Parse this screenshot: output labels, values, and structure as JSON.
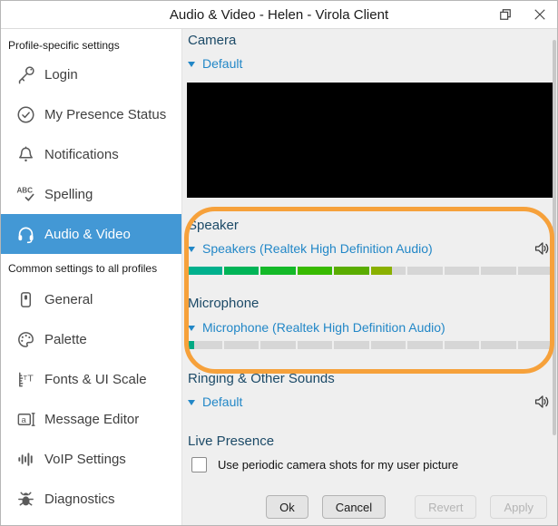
{
  "window": {
    "title": "Audio & Video - Helen - Virola Client"
  },
  "colors": {
    "accent": "#4398d5",
    "link": "#2287c7",
    "heading": "#1c4a67",
    "highlight": "#f6a13b"
  },
  "sidebar": {
    "groups": [
      {
        "label": "Profile-specific settings",
        "items": [
          {
            "label": "Login",
            "icon": "key-icon",
            "selected": false
          },
          {
            "label": "My Presence Status",
            "icon": "presence-status-icon",
            "selected": false
          },
          {
            "label": "Notifications",
            "icon": "bell-icon",
            "selected": false
          },
          {
            "label": "Spelling",
            "icon": "spelling-icon",
            "selected": false
          },
          {
            "label": "Audio & Video",
            "icon": "headset-icon",
            "selected": true
          }
        ]
      },
      {
        "label": "Common settings to all profiles",
        "items": [
          {
            "label": "General",
            "icon": "general-icon",
            "selected": false
          },
          {
            "label": "Palette",
            "icon": "palette-icon",
            "selected": false
          },
          {
            "label": "Fonts & UI Scale",
            "icon": "fonts-scale-icon",
            "selected": false
          },
          {
            "label": "Message Editor",
            "icon": "message-editor-icon",
            "selected": false
          },
          {
            "label": "VoIP Settings",
            "icon": "voip-icon",
            "selected": false
          },
          {
            "label": "Diagnostics",
            "icon": "bug-icon",
            "selected": false
          }
        ]
      }
    ]
  },
  "main": {
    "camera": {
      "heading": "Camera",
      "device": "Default"
    },
    "speaker": {
      "heading": "Speaker",
      "device": "Speakers (Realtek High Definition Audio)",
      "meter": {
        "segments": 10,
        "levels": [
          1,
          1,
          1,
          1,
          1,
          0.6,
          0,
          0,
          0,
          0
        ],
        "fill_colors": [
          "#00b08d",
          "#00b457",
          "#14b928",
          "#38ba00",
          "#5aac00",
          "#8ab000",
          null,
          null,
          null,
          null
        ],
        "empty_color": "#d6d6d6"
      }
    },
    "microphone": {
      "heading": "Microphone",
      "device": "Microphone (Realtek High Definition Audio)",
      "meter": {
        "segments": 10,
        "levels": [
          0.2,
          0,
          0,
          0,
          0,
          0,
          0,
          0,
          0,
          0
        ],
        "fill_colors": [
          "#00a983",
          null,
          null,
          null,
          null,
          null,
          null,
          null,
          null,
          null
        ],
        "empty_color": "#d6d6d6"
      }
    },
    "ringing": {
      "heading": "Ringing & Other Sounds",
      "device": "Default"
    },
    "live_presence": {
      "heading": "Live Presence",
      "checkbox_label": "Use periodic camera shots for my user picture",
      "checked": false
    },
    "buttons": [
      {
        "label": "Ok",
        "enabled": true
      },
      {
        "label": "Cancel",
        "enabled": true
      },
      {
        "label": "Revert",
        "enabled": false
      },
      {
        "label": "Apply",
        "enabled": false
      }
    ]
  }
}
